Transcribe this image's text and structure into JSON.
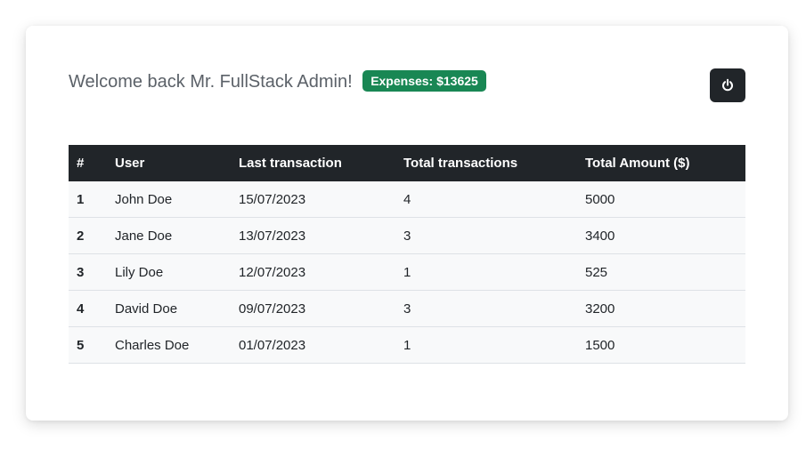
{
  "header": {
    "welcome_text": "Welcome back Mr. FullStack Admin!",
    "expenses_badge": "Expenses: $13625",
    "power_button_icon": "power-icon"
  },
  "colors": {
    "badge_bg": "#198754",
    "header_bg": "#212529",
    "row_bg": "#f8f9fa"
  },
  "table": {
    "columns": [
      "#",
      "User",
      "Last transaction",
      "Total transactions",
      "Total Amount ($)"
    ],
    "rows": [
      {
        "index": "1",
        "user": "John Doe",
        "last_transaction": "15/07/2023",
        "total_transactions": "4",
        "total_amount": "5000"
      },
      {
        "index": "2",
        "user": "Jane Doe",
        "last_transaction": "13/07/2023",
        "total_transactions": "3",
        "total_amount": "3400"
      },
      {
        "index": "3",
        "user": "Lily Doe",
        "last_transaction": "12/07/2023",
        "total_transactions": "1",
        "total_amount": "525"
      },
      {
        "index": "4",
        "user": "David Doe",
        "last_transaction": "09/07/2023",
        "total_transactions": "3",
        "total_amount": "3200"
      },
      {
        "index": "5",
        "user": "Charles Doe",
        "last_transaction": "01/07/2023",
        "total_transactions": "1",
        "total_amount": "1500"
      }
    ]
  }
}
